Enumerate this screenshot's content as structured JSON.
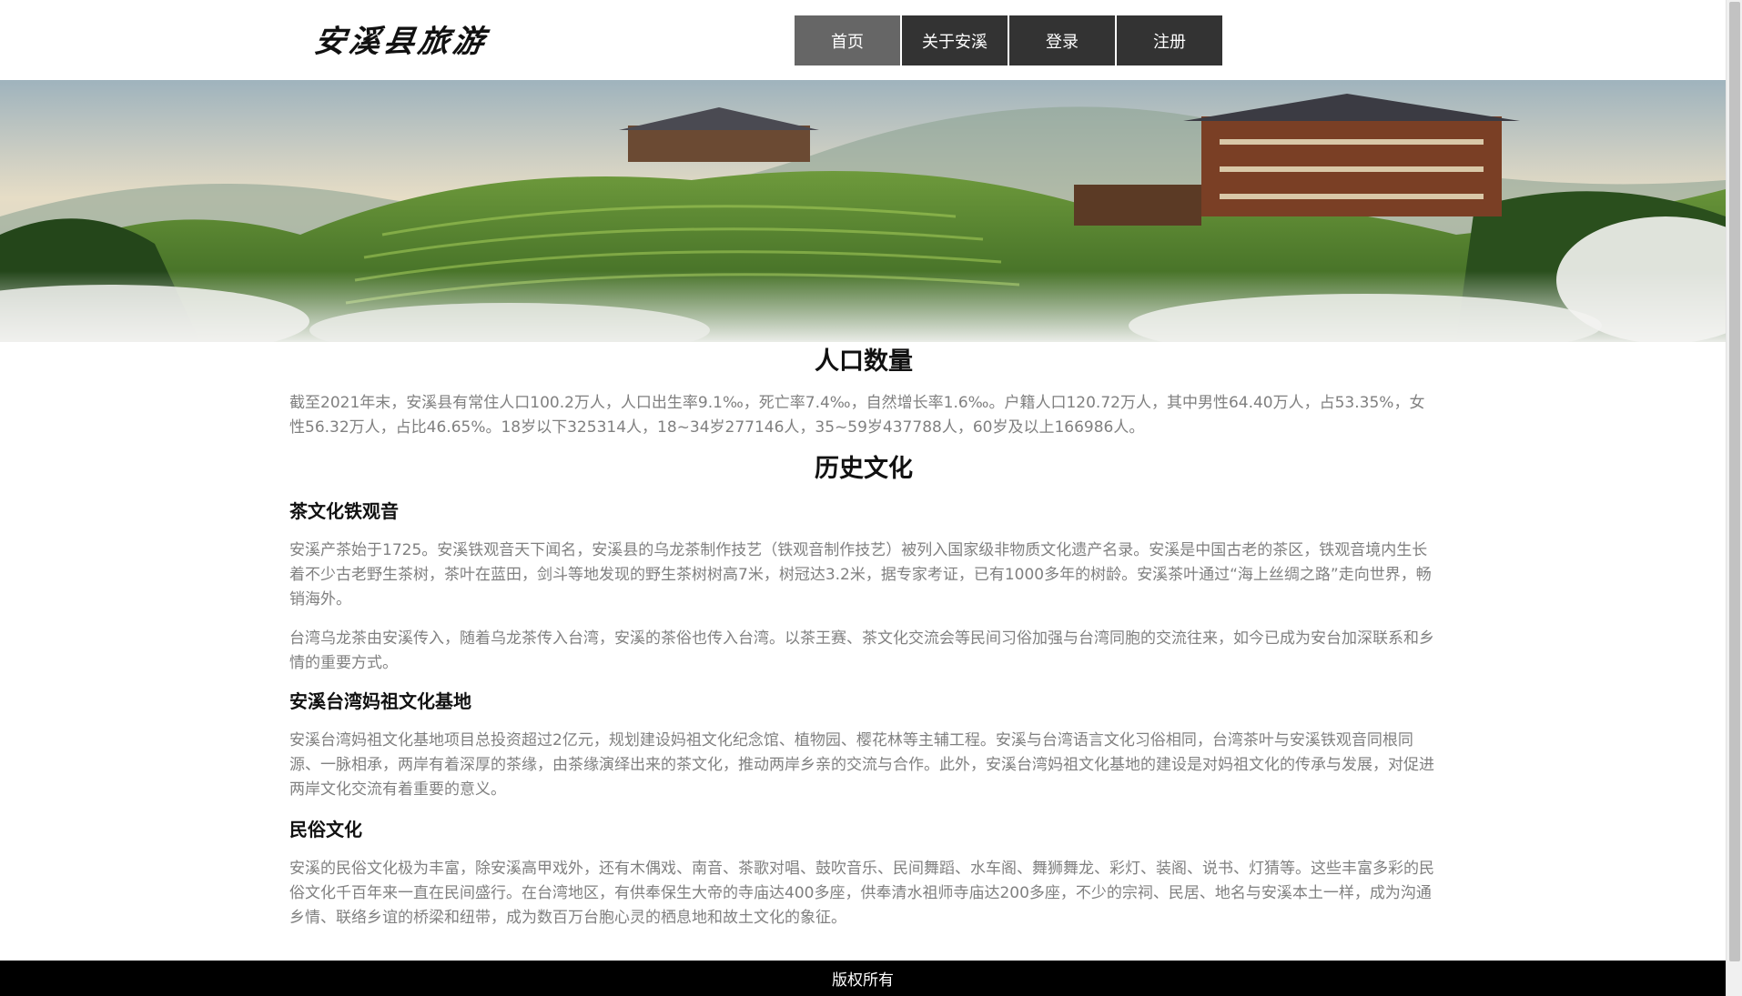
{
  "header": {
    "logo_text": "安溪县旅游",
    "nav": [
      {
        "label": "首页",
        "active": true
      },
      {
        "label": "关于安溪",
        "active": false
      },
      {
        "label": "登录",
        "active": false
      },
      {
        "label": "注册",
        "active": false
      }
    ]
  },
  "banner": {
    "image": "tea-terrace-mountain-landscape"
  },
  "sections": {
    "population": {
      "title": "人口数量",
      "text": "截至2021年末，安溪县有常住人口100.2万人，人口出生率9.1‰，死亡率7.4‰，自然增长率1.6‰。户籍人口120.72万人，其中男性64.40万人，占53.35%，女性56.32万人，占比46.65%。18岁以下325314人，18~34岁277146人，35~59岁437788人，60岁及以上166986人。"
    },
    "history": {
      "title": "历史文化",
      "tea": {
        "title": "茶文化铁观音",
        "p1": "安溪产茶始于1725。安溪铁观音天下闻名，安溪县的乌龙茶制作技艺（铁观音制作技艺）被列入国家级非物质文化遗产名录。安溪是中国古老的茶区，铁观音境内生长着不少古老野生茶树，茶叶在蓝田，剑斗等地发现的野生茶树树高7米，树冠达3.2米，据专家考证，已有1000多年的树龄。安溪茶叶通过“海上丝绸之路”走向世界，畅销海外。",
        "p2": "台湾乌龙茶由安溪传入，随着乌龙茶传入台湾，安溪的茶俗也传入台湾。以茶王赛、茶文化交流会等民间习俗加强与台湾同胞的交流往来，如今已成为安台加深联系和乡情的重要方式。"
      },
      "mazu": {
        "title": "安溪台湾妈祖文化基地",
        "p1": "安溪台湾妈祖文化基地项目总投资超过2亿元，规划建设妈祖文化纪念馆、植物园、樱花林等主辅工程。安溪与台湾语言文化习俗相同，台湾茶叶与安溪铁观音同根同源、一脉相承，两岸有着深厚的茶缘，由茶缘演绎出来的茶文化，推动两岸乡亲的交流与合作。此外，安溪台湾妈祖文化基地的建设是对妈祖文化的传承与发展，对促进两岸文化交流有着重要的意义。"
      },
      "folk": {
        "title": "民俗文化",
        "p1": "安溪的民俗文化极为丰富，除安溪高甲戏外，还有木偶戏、南音、茶歌对唱、鼓吹音乐、民间舞蹈、水车阁、舞狮舞龙、彩灯、装阁、说书、灯猜等。这些丰富多彩的民俗文化千百年来一直在民间盛行。在台湾地区，有供奉保生大帝的寺庙达400多座，供奉清水祖师寺庙达200多座，不少的宗祠、民居、地名与安溪本土一样，成为沟通乡情、联络乡谊的桥梁和纽带，成为数百万台胞心灵的栖息地和故土文化的象征。"
      }
    }
  },
  "footer": {
    "text": "版权所有"
  }
}
